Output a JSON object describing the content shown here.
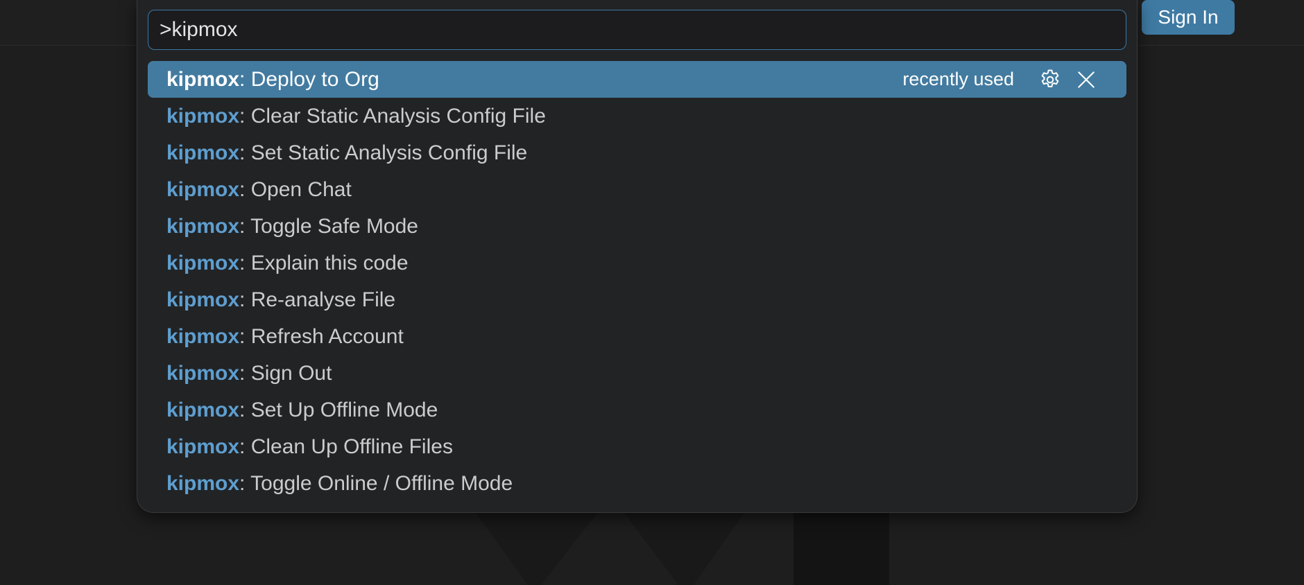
{
  "palette": {
    "input_value": ">kipmox",
    "items": [
      {
        "prefix": "kipmox",
        "label": ": Deploy to Org",
        "hint": "recently used",
        "selected": true
      },
      {
        "prefix": "kipmox",
        "label": ": Clear Static Analysis Config File"
      },
      {
        "prefix": "kipmox",
        "label": ": Set Static Analysis Config File"
      },
      {
        "prefix": "kipmox",
        "label": ": Open Chat"
      },
      {
        "prefix": "kipmox",
        "label": ": Toggle Safe Mode"
      },
      {
        "prefix": "kipmox",
        "label": ": Explain this code"
      },
      {
        "prefix": "kipmox",
        "label": ": Re-analyse File"
      },
      {
        "prefix": "kipmox",
        "label": ": Refresh Account"
      },
      {
        "prefix": "kipmox",
        "label": ": Sign Out"
      },
      {
        "prefix": "kipmox",
        "label": ": Set Up Offline Mode"
      },
      {
        "prefix": "kipmox",
        "label": ": Clean Up Offline Files"
      },
      {
        "prefix": "kipmox",
        "label": ": Toggle Online / Offline Mode"
      }
    ],
    "row_icons": [
      "gear-icon",
      "close-icon"
    ]
  },
  "header": {
    "signin_label": "Sign In"
  },
  "colors": {
    "accent": "#437ba0",
    "prefix": "#5e9ecf",
    "background": "#1e1e1e",
    "panel": "#222325"
  }
}
